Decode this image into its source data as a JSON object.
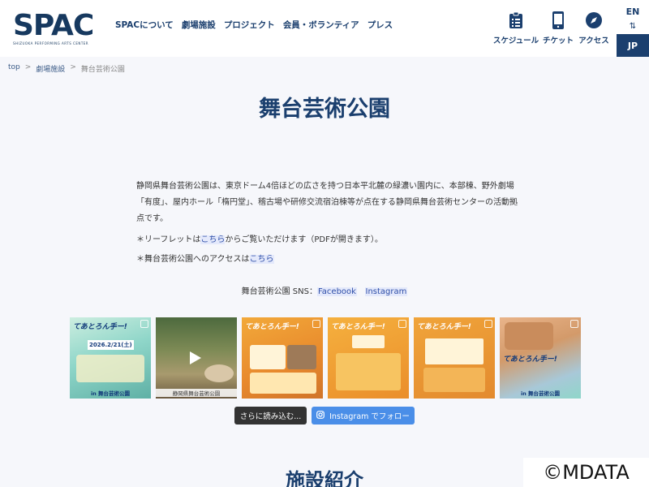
{
  "header": {
    "logo_text": "SPAC",
    "logo_sub": "SHIZUOKA PERFORMING ARTS CENTER",
    "nav": [
      "SPACについて",
      "劇場施設",
      "プロジェクト",
      "会員・ボランティア",
      "プレス"
    ],
    "quick": [
      {
        "label": "スケジュール",
        "icon": "schedule-icon"
      },
      {
        "label": "チケット",
        "icon": "ticket-icon"
      },
      {
        "label": "アクセス",
        "icon": "compass-icon"
      }
    ],
    "lang": {
      "en": "EN",
      "arrows": "⇅",
      "jp": "JP"
    }
  },
  "breadcrumb": {
    "home": "top",
    "parent": "劇場施設",
    "current": "舞台芸術公園",
    "sep": ">"
  },
  "page_title": "舞台芸術公園",
  "intro": "静岡県舞台芸術公園は、東京ドーム4倍ほどの広さを持つ日本平北麓の緑濃い園内に、本部棟、野外劇場「有度」、屋内ホール「楕円堂」、稽古場や研修交流宿泊棟等が点在する静岡県舞台芸術センターの活動拠点です。",
  "note1": {
    "before": "＊リーフレットは",
    "link": "こちら",
    "after": "からご覧いただけます（PDFが開きます）。"
  },
  "note2": {
    "before": "＊舞台芸術公園へのアクセスは",
    "link": "こちら"
  },
  "sns": {
    "label": "舞台芸術公園 SNS：",
    "facebook": "Facebook",
    "instagram": "Instagram"
  },
  "instagram_tiles": [
    {
      "head": "てあとろん手ー!",
      "foot": "in 舞台芸術公園",
      "date": "2026.2/21(土)"
    },
    {
      "head": "",
      "foot": "静岡県舞台芸術公園",
      "video": true
    },
    {
      "head": "てあとろん手ー!",
      "foot": ""
    },
    {
      "head": "てあとろん手ー!",
      "foot": ""
    },
    {
      "head": "てあとろん手ー!",
      "foot": ""
    },
    {
      "head": "てあとろん手ー!",
      "foot": "in 舞台芸術公園"
    }
  ],
  "buttons": {
    "load_more": "さらに読み込む...",
    "follow": "Instagram でフォロー"
  },
  "section_title": "施設紹介",
  "watermark": "©MDATA"
}
